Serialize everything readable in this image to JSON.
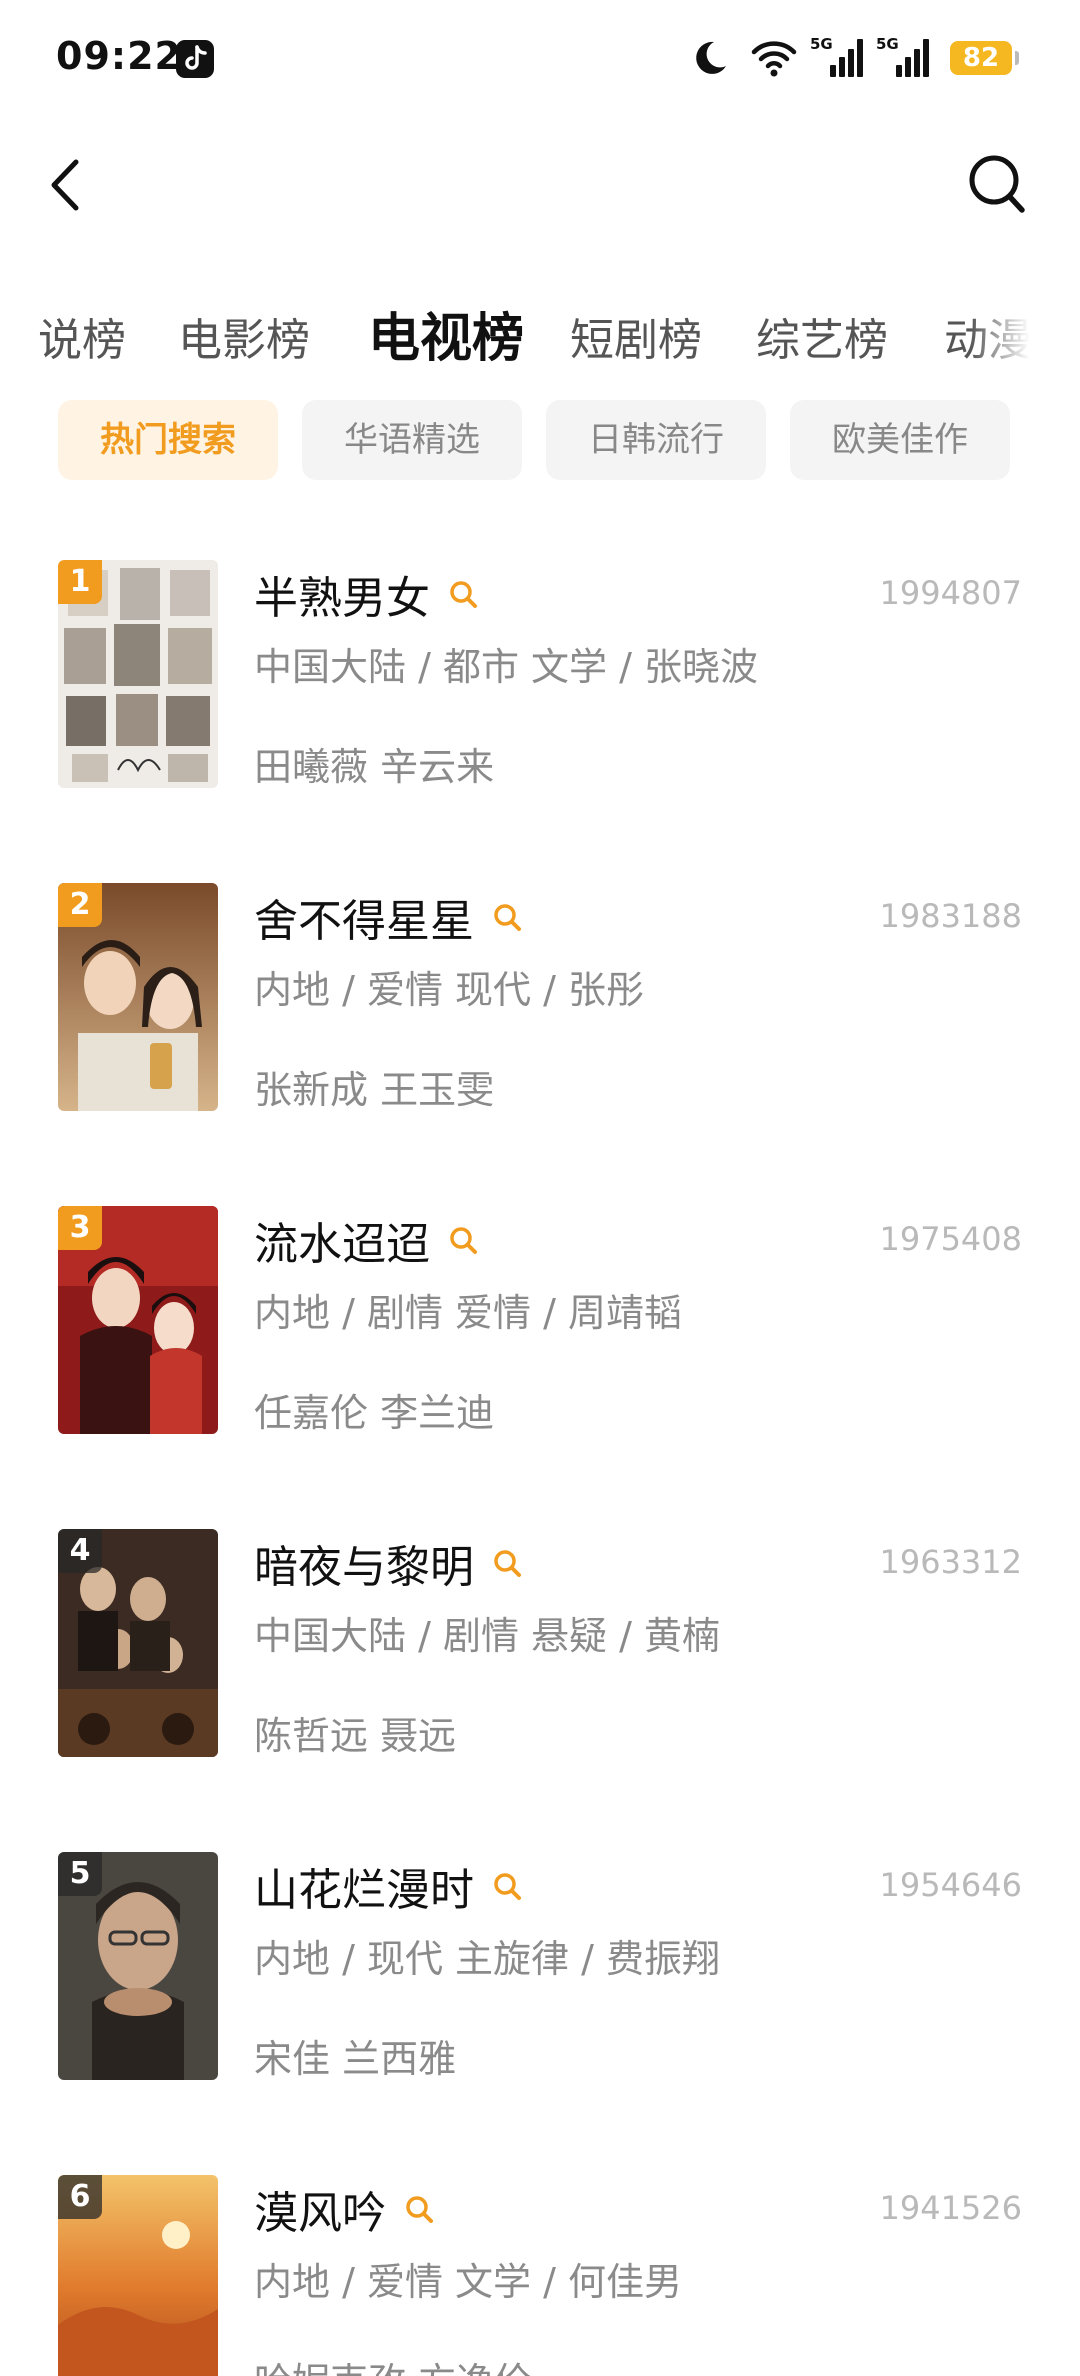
{
  "status_bar": {
    "time": "09:22",
    "signal_1": "5G",
    "signal_2": "5G",
    "battery": "82"
  },
  "nav": {
    "back_icon": "chevron-left-icon",
    "search_icon": "search-icon"
  },
  "category_tabs": [
    {
      "label": "说榜"
    },
    {
      "label": "电影榜"
    },
    {
      "label": "电视榜",
      "active": true
    },
    {
      "label": "短剧榜"
    },
    {
      "label": "综艺榜"
    },
    {
      "label": "动漫榜"
    }
  ],
  "sub_tabs": [
    {
      "label": "热门搜索",
      "active": true
    },
    {
      "label": "华语精选"
    },
    {
      "label": "日韩流行"
    },
    {
      "label": "欧美佳作"
    }
  ],
  "colors": {
    "accent": "#f29c1f",
    "accent_bg": "#fff3e4",
    "muted_text": "#8a8a8a"
  },
  "items": [
    {
      "rank": "1",
      "title": "半熟男女",
      "heat": "1994807",
      "meta": "中国大陆 / 都市 文学 / 张晓波",
      "cast": "田曦薇 辛云来"
    },
    {
      "rank": "2",
      "title": "舍不得星星",
      "heat": "1983188",
      "meta": "内地 / 爱情 现代 / 张彤",
      "cast": "张新成 王玉雯"
    },
    {
      "rank": "3",
      "title": "流水迢迢",
      "heat": "1975408",
      "meta": "内地 / 剧情 爱情 / 周靖韬",
      "cast": "任嘉伦 李兰迪"
    },
    {
      "rank": "4",
      "title": "暗夜与黎明",
      "heat": "1963312",
      "meta": "中国大陆 / 剧情 悬疑 / 黄楠",
      "cast": "陈哲远 聂远"
    },
    {
      "rank": "5",
      "title": "山花烂漫时",
      "heat": "1954646",
      "meta": "内地 / 现代 主旋律 / 费振翔",
      "cast": "宋佳 兰西雅"
    },
    {
      "rank": "6",
      "title": "漠风吟",
      "heat": "1941526",
      "meta": "内地 / 爱情 文学 / 何佳男",
      "cast": "哈妮克孜 方逸伦"
    }
  ]
}
